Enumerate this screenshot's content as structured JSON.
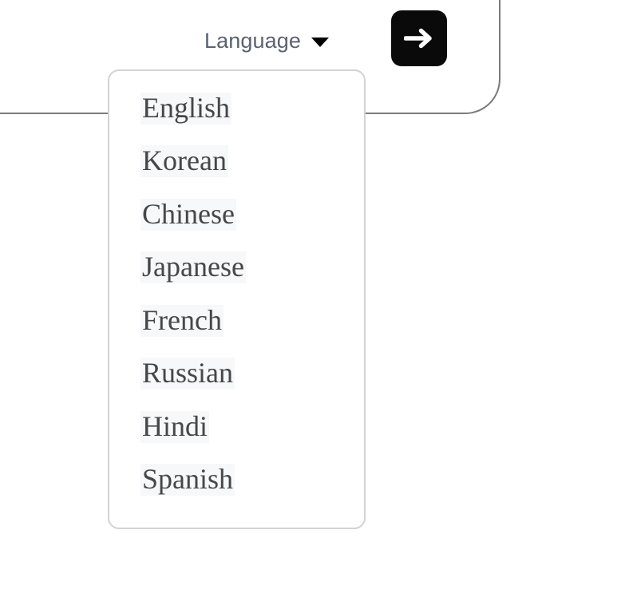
{
  "header_card": {
    "name": "header-card",
    "border_color": "#7a7a7a"
  },
  "language_selector": {
    "trigger_label": "Language",
    "caret_icon": "chevron-down-icon",
    "text_color": "#5b6270",
    "expanded": true,
    "options": [
      {
        "label": "English"
      },
      {
        "label": "Korean"
      },
      {
        "label": "Chinese"
      },
      {
        "label": "Japanese"
      },
      {
        "label": "French"
      },
      {
        "label": "Russian"
      },
      {
        "label": "Hindi"
      },
      {
        "label": "Spanish"
      }
    ],
    "menu_border_color": "#d3d3d3",
    "item_highlight_color": "#f6f8fa",
    "item_text_color": "#474747"
  },
  "submit_button": {
    "icon": "arrow-right-icon",
    "background": "#0a0a0a",
    "icon_color": "#ffffff"
  }
}
